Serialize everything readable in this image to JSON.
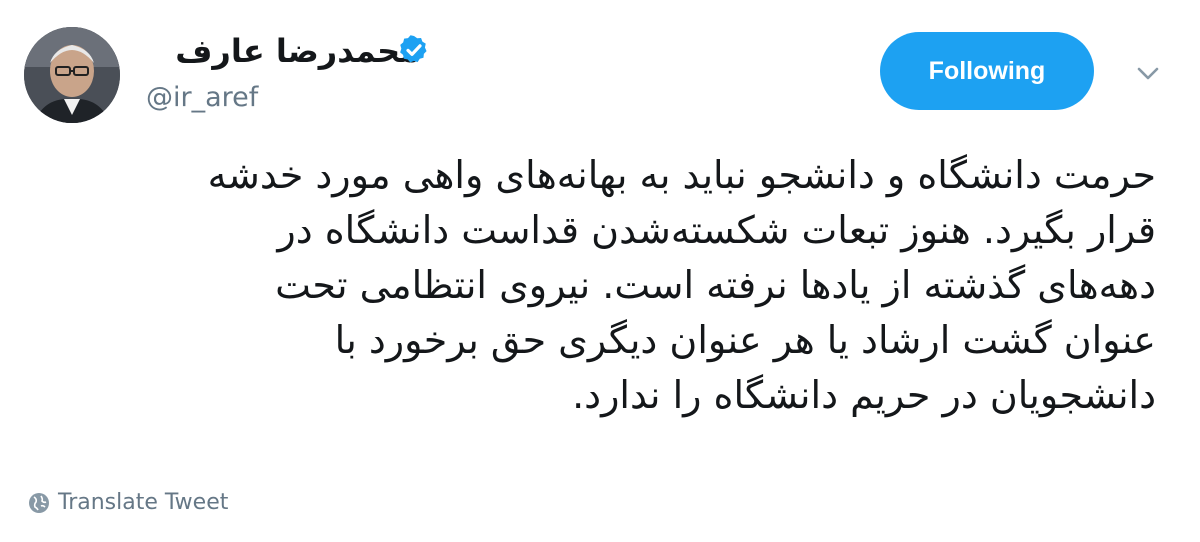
{
  "author": {
    "name": "محمدرضا عارف",
    "handle": "@ir_aref",
    "verified": true
  },
  "actions": {
    "follow_label": "Following",
    "menu_icon": "chevron-down-icon"
  },
  "tweet": {
    "lines": [
      "حرمت دانشگاه و دانشجو نباید به بهانه‌های واهی مورد خدشه",
      "قرار بگیرد. هنوز تبعات شکسته‌شدن قداست دانشگاه در",
      "دهه‌های گذشته از یادها نرفته است. نیروی انتظامی تحت",
      "عنوان گشت ارشاد یا هر عنوان دیگری حق برخورد با",
      "دانشجویان در حریم دانشگاه را ندارد."
    ]
  },
  "translate": {
    "label": "Translate Tweet",
    "icon": "globe-icon"
  },
  "colors": {
    "accent": "#1da1f2",
    "text": "#14171a",
    "muted": "#657786"
  }
}
